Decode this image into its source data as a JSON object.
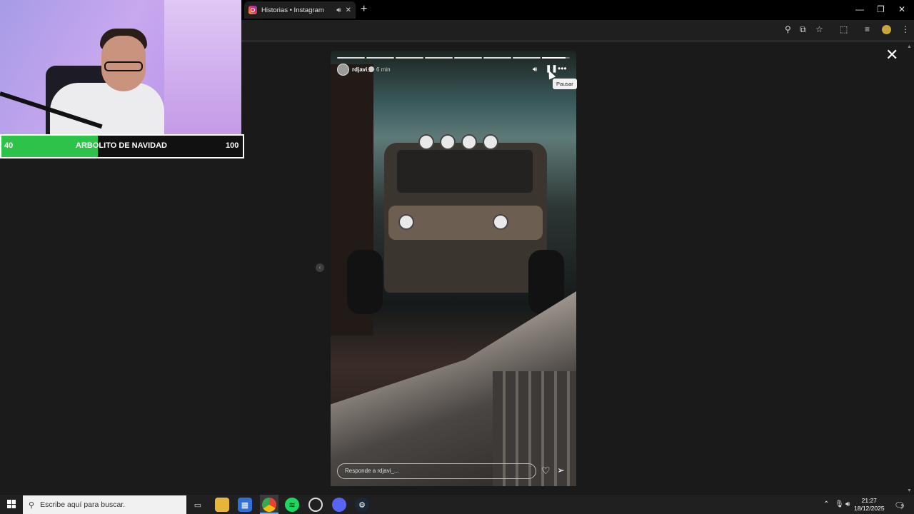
{
  "browser": {
    "tab_title": "Historias • Instagram",
    "tab_icon": "instagram-icon",
    "tab_audio_icon": "speaker-icon",
    "tab_close_icon": "close-icon",
    "new_tab_label": "+",
    "window_controls": [
      "minimize-icon",
      "restore-icon",
      "close-icon"
    ],
    "toolbar_icons": [
      "zoom-icon",
      "install-app-icon",
      "bookmark-star-icon",
      "extensions-icon",
      "media-controls-icon",
      "profile-icon",
      "menu-icon"
    ]
  },
  "webcam": {
    "bar_min": "40",
    "bar_label": "ARBOLITO DE NAVIDAD",
    "bar_max": "100",
    "bar_progress": 0.4,
    "accent": "#2dc24a"
  },
  "story": {
    "username": "rdjavi_",
    "time_ago": "6 min",
    "pause_tooltip": "Pausar",
    "reply_placeholder": "Responde a rdjavi_...",
    "segments_total": 8,
    "current_segment": 8,
    "current_progress": 0.85,
    "icons": [
      "volume-icon",
      "pause-icon",
      "more-icon",
      "heart-icon",
      "send-icon",
      "close-icon",
      "chevron-left-icon"
    ]
  },
  "taskbar": {
    "search_placeholder": "Escribe aquí para buscar.",
    "apps": [
      "task-view-icon",
      "file-explorer-icon",
      "store-icon",
      "chrome-icon",
      "spotify-icon",
      "app-icon",
      "discord-icon",
      "steam-icon"
    ],
    "time": "21:27",
    "date": "18/12/2025",
    "notification_count": "9"
  }
}
